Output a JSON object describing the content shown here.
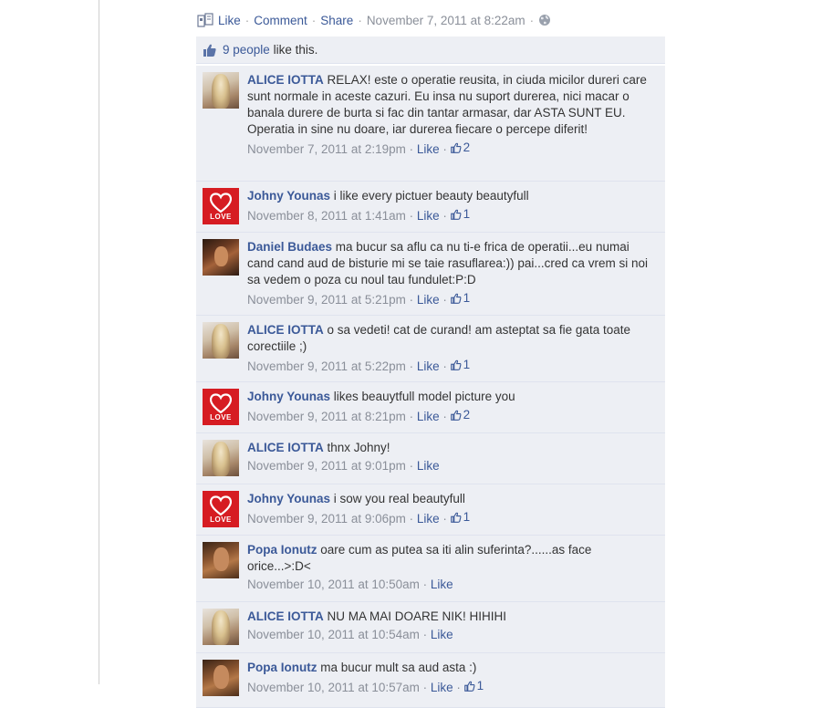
{
  "actions": {
    "like": "Like",
    "comment": "Comment",
    "share": "Share",
    "timestamp": "November 7, 2011 at 8:22am"
  },
  "likes": {
    "people": "9 people",
    "suffix": "like this."
  },
  "comments": [
    {
      "author": "ALICE IOTTA",
      "text": "RELAX! este o operatie reusita, in ciuda micilor dureri care sunt normale in aceste cazuri. Eu insa nu suport durerea, nici macar o banala durere de burta si fac din tantar armasar, dar ASTA SUNT EU. Operatia in sine nu doare, iar durerea fiecare o percepe diferit!",
      "time": "November 7, 2011 at 2:19pm",
      "like": "Like",
      "likes": "2"
    },
    {
      "author": "Johny Younas",
      "text": "i like every pictuer beauty beautyfull",
      "time": "November 8, 2011 at 1:41am",
      "like": "Like",
      "likes": "1"
    },
    {
      "author": "Daniel Budaes",
      "text": "ma bucur sa aflu ca nu ti-e frica de operatii...eu numai cand cand aud de bisturie mi se taie rasuflarea:)) pai...cred ca vrem si noi sa vedem o poza cu noul tau fundulet:P:D",
      "time": "November 9, 2011 at 5:21pm",
      "like": "Like",
      "likes": "1"
    },
    {
      "author": "ALICE IOTTA",
      "text": "o sa vedeti! cat de curand! am asteptat sa fie gata toate corectiile ;)",
      "time": "November 9, 2011 at 5:22pm",
      "like": "Like",
      "likes": "1"
    },
    {
      "author": "Johny Younas",
      "text": "likes beauytfull model picture you",
      "time": "November 9, 2011 at 8:21pm",
      "like": "Like",
      "likes": "2"
    },
    {
      "author": "ALICE IOTTA",
      "text": "thnx Johny!",
      "time": "November 9, 2011 at 9:01pm",
      "like": "Like",
      "likes": ""
    },
    {
      "author": "Johny Younas",
      "text": "i sow you real beautyfull",
      "time": "November 9, 2011 at 9:06pm",
      "like": "Like",
      "likes": "1"
    },
    {
      "author": "Popa Ionutz",
      "text": "oare cum as putea sa iti alin suferinta?......as face orice...>:D<",
      "time": "November 10, 2011 at 10:50am",
      "like": "Like",
      "likes": ""
    },
    {
      "author": "ALICE IOTTA",
      "text": "NU MA MAI DOARE NIK! HIHIHI",
      "time": "November 10, 2011 at 10:54am",
      "like": "Like",
      "likes": ""
    },
    {
      "author": "Popa Ionutz",
      "text": "ma bucur mult sa aud asta :)",
      "time": "November 10, 2011 at 10:57am",
      "like": "Like",
      "likes": "1"
    }
  ],
  "avatar_labels": {
    "love": "LOVE"
  },
  "colors": {
    "link": "#3b5998",
    "comment_bg": "#edeff4",
    "border": "#dfe3ee",
    "love_red": "#d61c22"
  }
}
